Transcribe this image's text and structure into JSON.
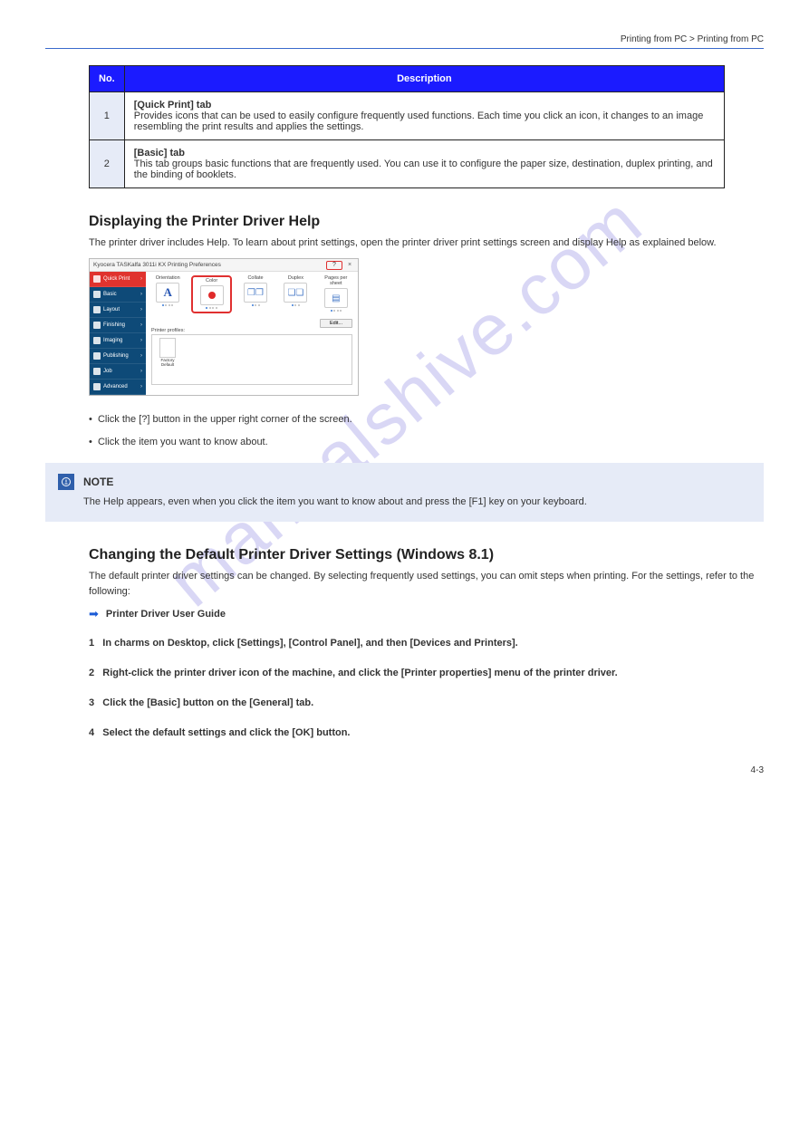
{
  "header": {
    "right_text": "Printing from PC > Printing from PC",
    "page_num": "4-3"
  },
  "table": {
    "head_no": "No.",
    "head_desc": "Description",
    "rows": [
      {
        "no": "1",
        "desc_line1": "[Quick Print] tab",
        "desc_line2": "Provides icons that can be used to easily configure frequently used functions. Each time you click an icon, it changes to an image resembling the print results and applies the settings."
      },
      {
        "no": "2",
        "desc_line1": "[Basic] tab",
        "desc_line2": "This tab groups basic functions that are frequently used. You can use it to configure the paper size, destination, duplex printing, and the binding of booklets."
      }
    ]
  },
  "section_help": {
    "title": "Displaying the Printer Driver Help",
    "body": "The printer driver includes Help. To learn about print settings, open the printer driver print settings screen and display Help as explained below."
  },
  "dialog": {
    "title": "Kyocera TASKalfa 3011i KX Printing Preferences",
    "help": "?",
    "close": "×",
    "sidebar": [
      "Quick Print",
      "Basic",
      "Layout",
      "Finishing",
      "Imaging",
      "Publishing",
      "Job",
      "Advanced"
    ],
    "options": [
      "Orientation",
      "Color",
      "Collate",
      "Duplex",
      "Pages per sheet"
    ],
    "edit_btn": "Edit...",
    "profiles_label": "Printer profiles:",
    "profile_name": "Factory Default"
  },
  "bullets": {
    "b1": "Click the [?] button in the upper right corner of the screen.",
    "b2": "Click the item you want to know about."
  },
  "note": {
    "title": "NOTE",
    "body": "The Help appears, even when you click the item you want to know about and press the [F1] key on your keyboard."
  },
  "section_change": {
    "title": "Changing the Default Printer Driver Settings (Windows 8.1)",
    "body": "The default printer driver settings can be changed. By selecting frequently used settings, you can omit steps when printing. For the settings, refer to the following:",
    "link": "Printer Driver User Guide",
    "s1_title": "In charms on Desktop, click [Settings], [Control Panel], and then [Devices and Printers].",
    "s2_title": "Right-click the printer driver icon of the machine, and click the [Printer properties] menu of the printer driver.",
    "s3_title": "Click the [Basic] button on the [General] tab.",
    "s4_title": "Select the default settings and click the [OK] button."
  },
  "steps": {
    "n1": "1",
    "n2": "2",
    "n3": "3",
    "n4": "4"
  }
}
